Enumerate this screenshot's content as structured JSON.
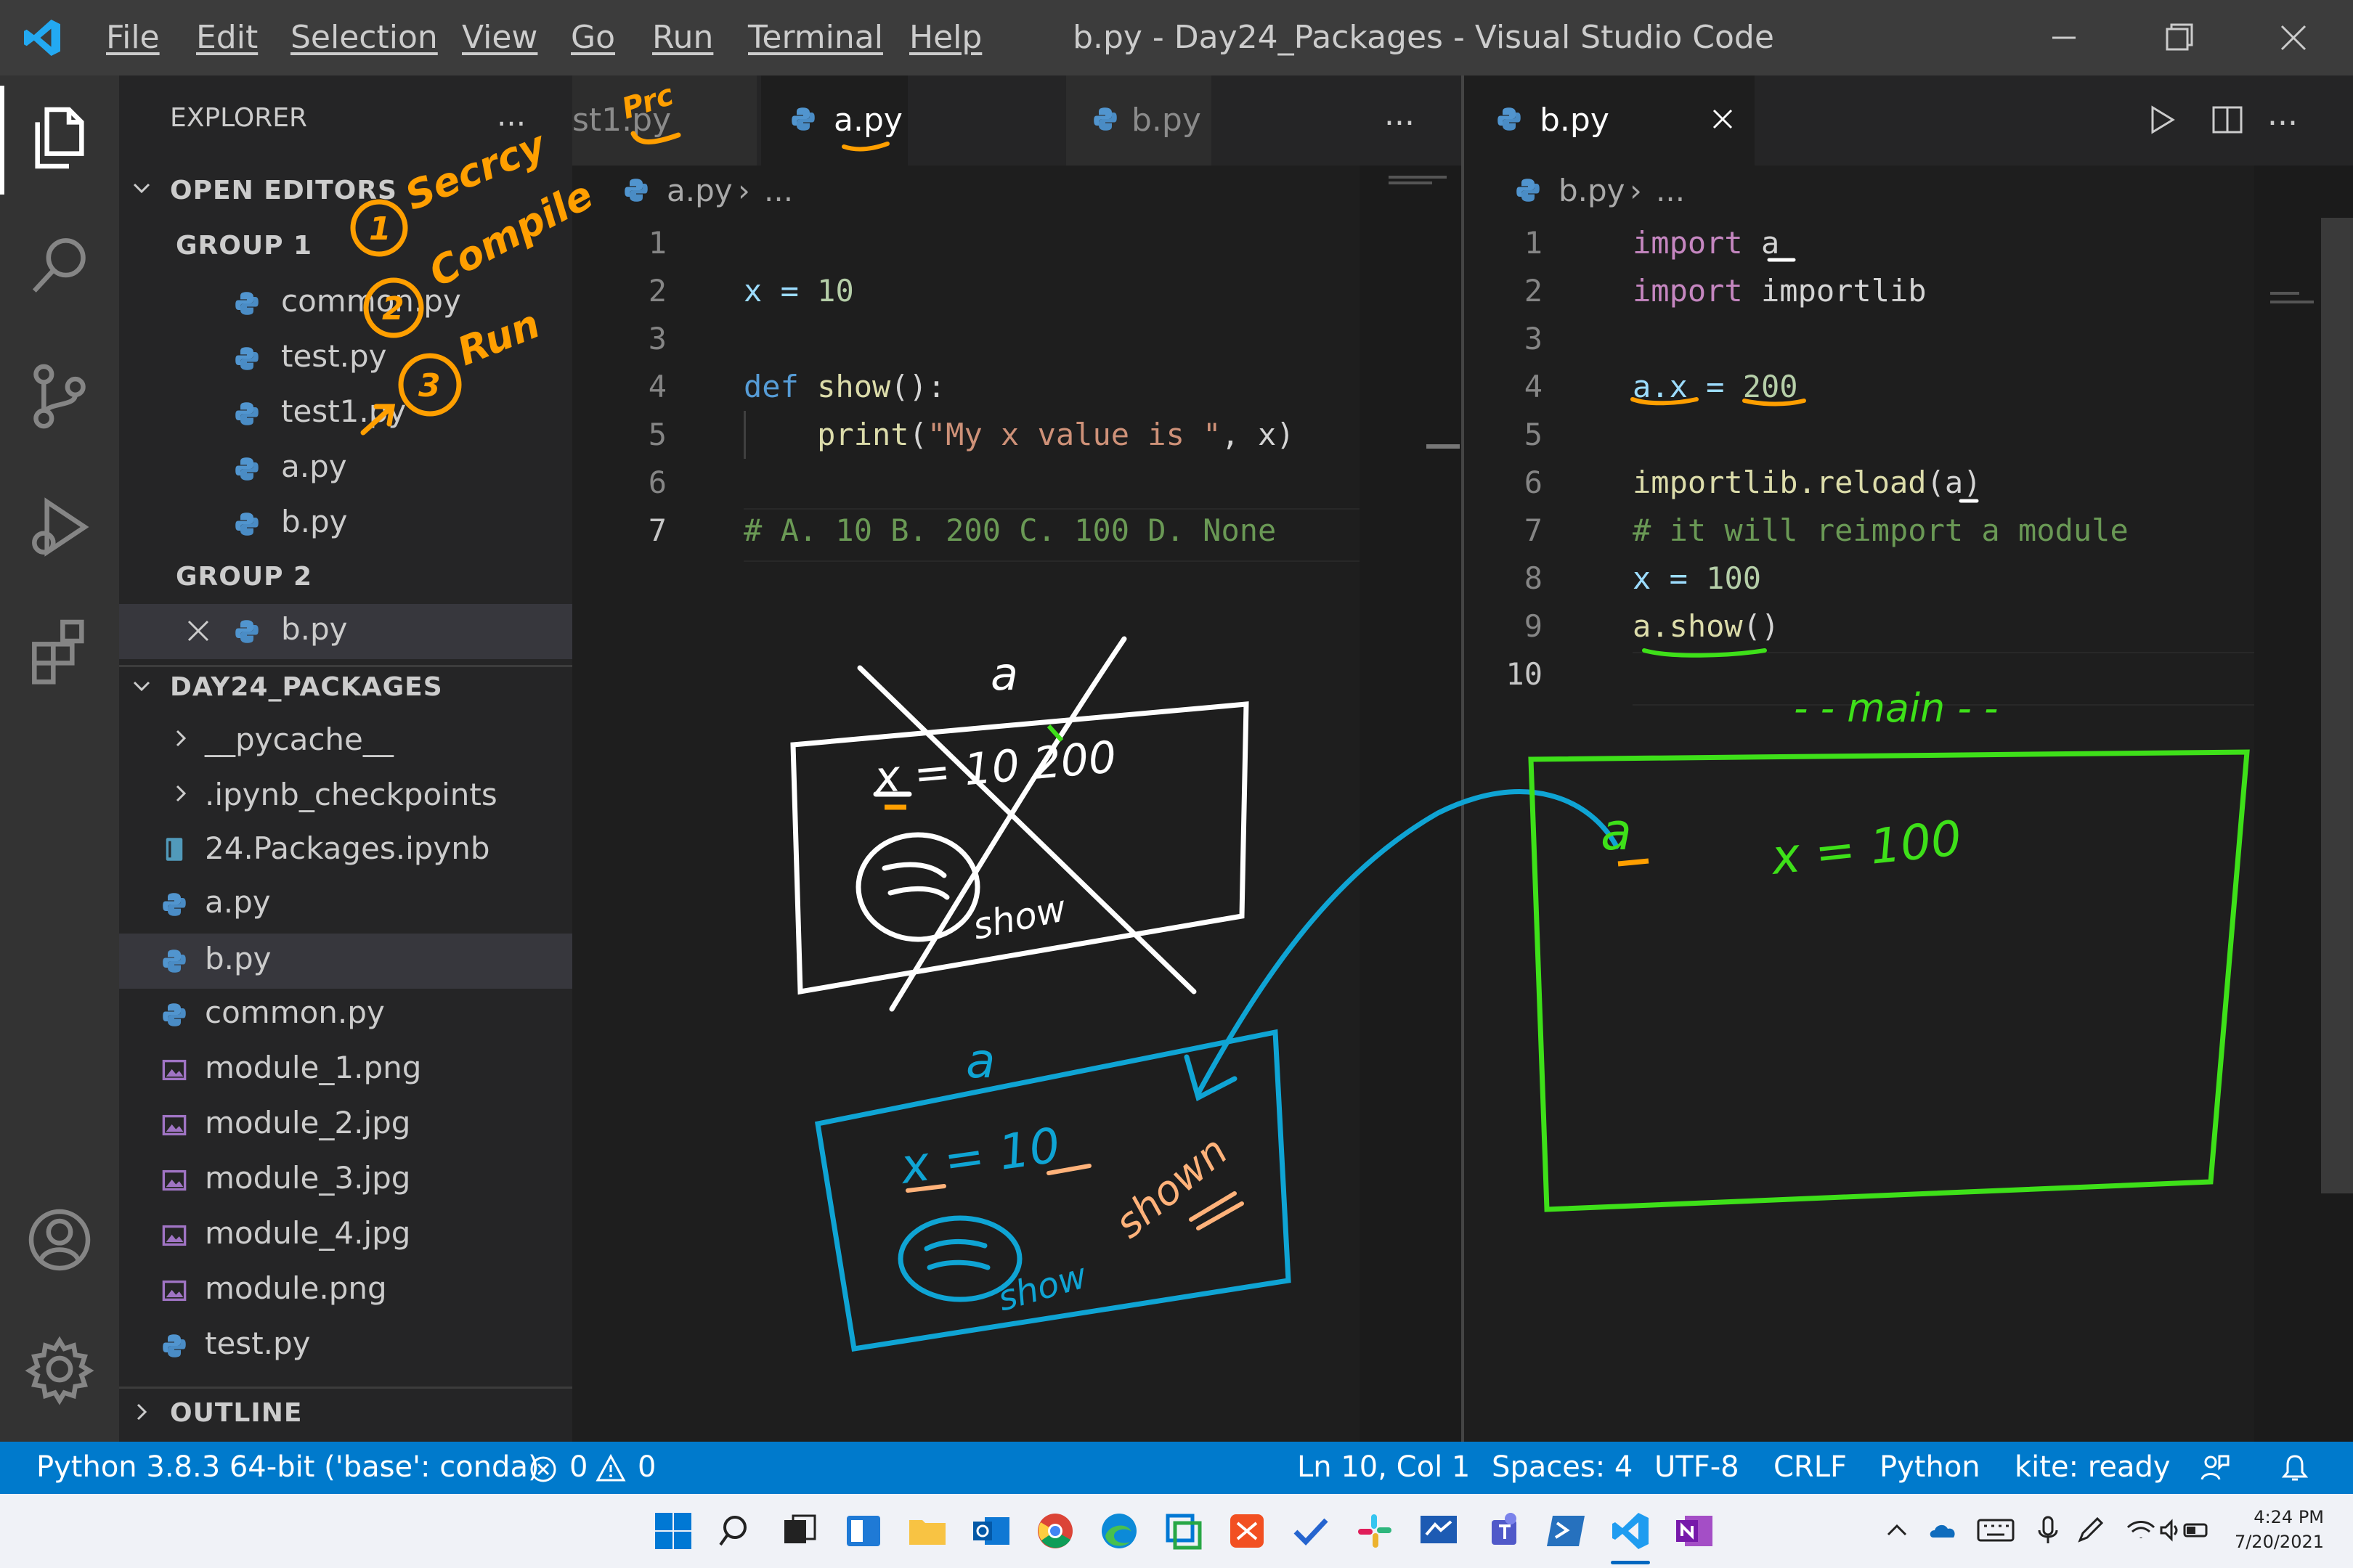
{
  "window": {
    "title": "b.py - Day24_Packages - Visual Studio Code"
  },
  "menu": [
    "File",
    "Edit",
    "Selection",
    "View",
    "Go",
    "Run",
    "Terminal",
    "Help"
  ],
  "sidebar": {
    "title": "EXPLORER",
    "more": "...",
    "open_editors": {
      "header": "OPEN EDITORS",
      "group1": {
        "label": "GROUP 1",
        "files": [
          "common.py",
          "test.py",
          "test1.py",
          "a.py",
          "b.py"
        ]
      },
      "group2": {
        "label": "GROUP 2",
        "files": [
          "b.py"
        ]
      }
    },
    "folder": {
      "header": "DAY24_PACKAGES",
      "items": [
        "__pycache__",
        ".ipynb_checkpoints",
        "24.Packages.ipynb",
        "a.py",
        "b.py",
        "common.py",
        "module_1.png",
        "module_2.jpg",
        "module_3.jpg",
        "module_4.jpg",
        "module.png",
        "test.py"
      ]
    },
    "outline": "OUTLINE"
  },
  "editor1": {
    "tabs": [
      "st1.py",
      "a.py",
      "b.py"
    ],
    "more": "...",
    "breadcrumb": {
      "file": "a.py",
      "rest": "..."
    },
    "line_numbers": [
      "1",
      "2",
      "3",
      "4",
      "5",
      "6",
      "7"
    ],
    "lines": {
      "l2": {
        "a": "x = ",
        "b": "10"
      },
      "l4": {
        "a": "def",
        "b": " show",
        "c": "():"
      },
      "l5": {
        "a": "    print",
        "b": "(",
        "c": "\"My x value is \"",
        "d": ", x)"
      },
      "l7": "# A. 10 B. 200 C. 100 D. None"
    }
  },
  "editor2": {
    "tabs": [
      "b.py"
    ],
    "more": "...",
    "breadcrumb": {
      "file": "b.py",
      "rest": "..."
    },
    "line_numbers": [
      "1",
      "2",
      "3",
      "4",
      "5",
      "6",
      "7",
      "8",
      "9",
      "10"
    ],
    "lines": {
      "l1": {
        "a": "import",
        "b": " a"
      },
      "l2": {
        "a": "import",
        "b": " importlib"
      },
      "l4": {
        "a": "a.x = ",
        "b": "200"
      },
      "l6": {
        "a": "importlib.reload",
        "b": "(a)"
      },
      "l7": "# it will reimport a module",
      "l8": {
        "a": "x = ",
        "b": "100"
      },
      "l9": {
        "a": "a.show",
        "b": "()"
      }
    }
  },
  "status": {
    "interpreter": "Python 3.8.3 64-bit ('base': conda)",
    "errors": "0",
    "warnings": "0",
    "position": "Ln 10, Col 1",
    "spaces": "Spaces: 4",
    "encoding": "UTF-8",
    "eol": "CRLF",
    "language": "Python",
    "kite": "kite: ready"
  },
  "taskbar": {
    "time": "4:24 PM",
    "date": "7/20/2021"
  },
  "annotations": {
    "steps": [
      "Secrcy",
      "Compile",
      "Run"
    ],
    "numbers": [
      "1",
      "2",
      "3"
    ],
    "prc": "Prc",
    "box_a_white_label": "a",
    "box_a_white_x": "x = 10 200",
    "box_a_white_show": "show",
    "box_a_blue_label": "a",
    "box_a_blue_x": "x = 10",
    "box_a_blue_show": "show",
    "box_a_blue_shown": "shown",
    "main_label": "- - main - -",
    "main_a": "a",
    "main_x": "x = 100"
  },
  "colors": {
    "accent": "#007acc",
    "ink_orange": "#ff9f00",
    "ink_green": "#3ee019",
    "ink_blue": "#0fa4d4",
    "ink_white": "#ffffff"
  }
}
